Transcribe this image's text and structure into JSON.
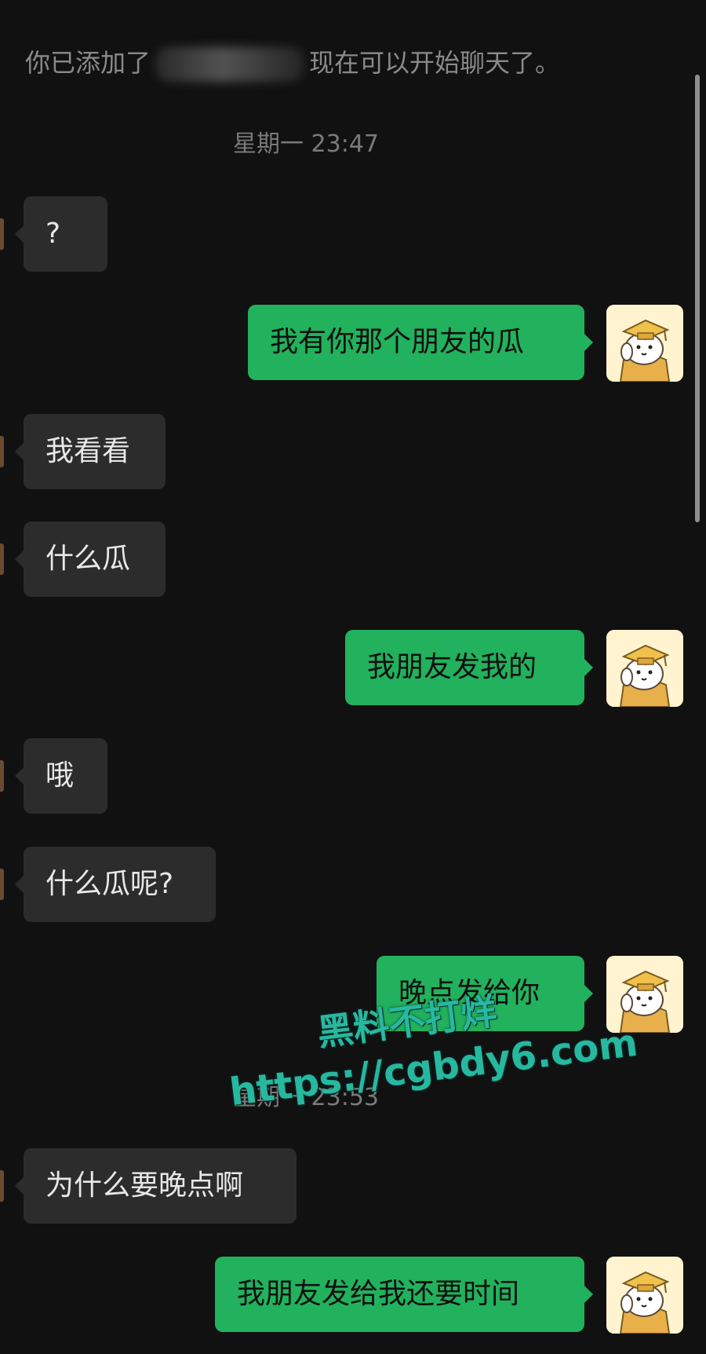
{
  "system_notice": {
    "before": "你已添加了",
    "after": "现在可以开始聊天了。"
  },
  "timestamps": [
    "星期一 23:47",
    "星期一 23:53"
  ],
  "messages": [
    {
      "side": "incoming",
      "text": "?"
    },
    {
      "side": "outgoing",
      "text": "我有你那个朋友的瓜"
    },
    {
      "side": "incoming",
      "text": "我看看"
    },
    {
      "side": "incoming",
      "text": "什么瓜"
    },
    {
      "side": "outgoing",
      "text": "我朋友发我的"
    },
    {
      "side": "incoming",
      "text": "哦"
    },
    {
      "side": "incoming",
      "text": "什么瓜呢?"
    },
    {
      "side": "outgoing",
      "text": "晚点发给你"
    },
    {
      "side": "incoming",
      "text": "为什么要晚点啊"
    },
    {
      "side": "outgoing",
      "text": "我朋友发给我还要时间"
    }
  ],
  "watermark": {
    "line1": "黑料不打烊",
    "line2": "https://cgbdy6.com"
  },
  "colors": {
    "background": "#111111",
    "incoming_bubble": "#2c2c2c",
    "outgoing_bubble": "#22b15c",
    "watermark": "#27b8a0"
  },
  "icons": {
    "avatar": "cartoon-dog-scholar-avatar"
  }
}
